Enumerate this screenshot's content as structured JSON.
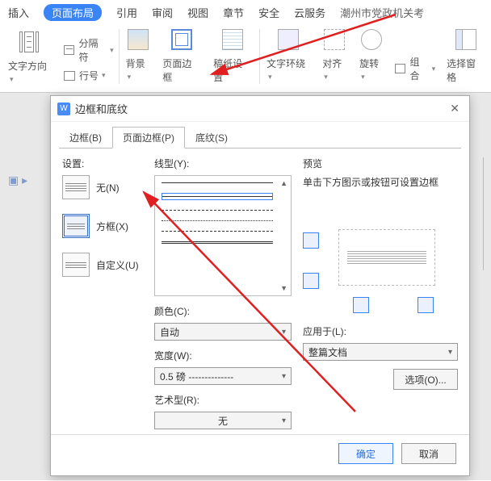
{
  "ribbon": {
    "tabs": [
      "插入",
      "页面布局",
      "引用",
      "审阅",
      "视图",
      "章节",
      "安全",
      "云服务"
    ],
    "active": 1,
    "tail": "潮州市党政机关考",
    "groups": {
      "g1": {
        "m1": "分隔符",
        "m2": "行号",
        "label": "文字方向"
      },
      "g2": "背景",
      "g3": "页面边框",
      "g4": "稿纸设置",
      "g5": "文字环绕",
      "g6": "对齐",
      "g7": "旋转",
      "g8a": "组合",
      "g8": "选择窗格"
    }
  },
  "dialog": {
    "title": "边框和底纹",
    "tabs": {
      "t1": "边框(B)",
      "t2": "页面边框(P)",
      "t3": "底纹(S)"
    },
    "settings_label": "设置:",
    "opt_none": "无(N)",
    "opt_box": "方框(X)",
    "opt_custom": "自定义(U)",
    "linetype_label": "线型(Y):",
    "color_label": "颜色(C):",
    "color_value": "自动",
    "width_label": "宽度(W):",
    "width_value": "0.5  磅 --------------",
    "art_label": "艺术型(R):",
    "art_value": "无",
    "preview_label": "预览",
    "preview_hint": "单击下方图示或按钮可设置边框",
    "apply_label": "应用于(L):",
    "apply_value": "整篇文档",
    "options_btn": "选项(O)...",
    "ok": "确定",
    "cancel": "取消"
  }
}
